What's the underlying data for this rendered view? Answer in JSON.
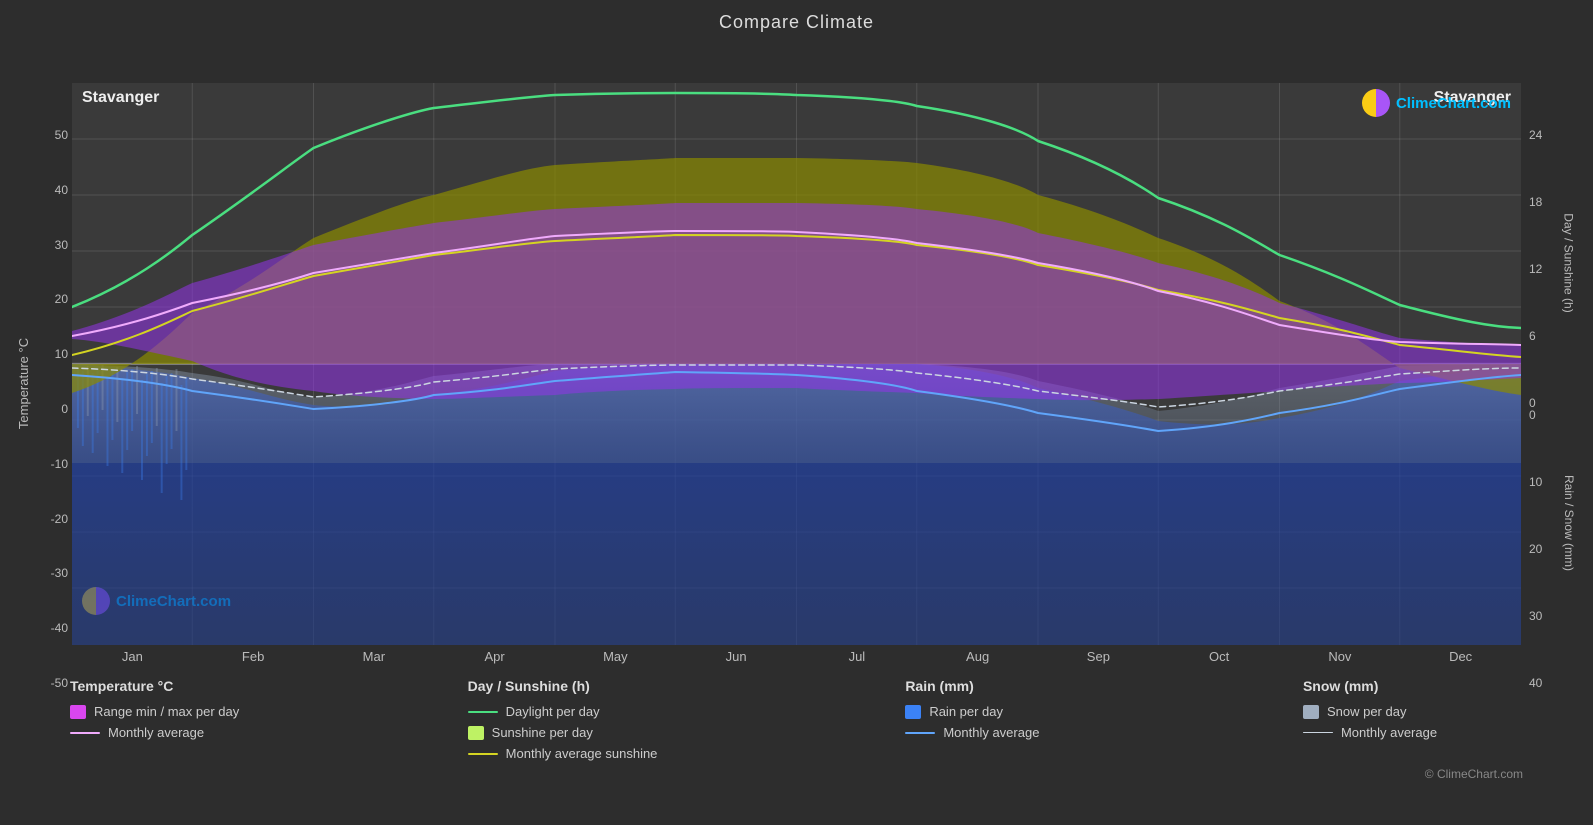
{
  "page": {
    "title": "Compare Climate",
    "bg_color": "#2d2d2d"
  },
  "header": {
    "city_left": "Stavanger",
    "city_right": "Stavanger",
    "logo_text": "ClimeChart.com"
  },
  "chart": {
    "y_axis_left_title": "Temperature °C",
    "y_axis_right_top_title": "Day / Sunshine (h)",
    "y_axis_right_bottom_title": "Rain / Snow (mm)",
    "y_left_labels": [
      "50",
      "40",
      "30",
      "20",
      "10",
      "0",
      "-10",
      "-20",
      "-30",
      "-40",
      "-50"
    ],
    "y_right_top_labels": [
      "24",
      "18",
      "12",
      "6",
      "0"
    ],
    "y_right_bottom_labels": [
      "0",
      "10",
      "20",
      "30",
      "40"
    ],
    "x_labels": [
      "Jan",
      "Feb",
      "Mar",
      "Apr",
      "May",
      "Jun",
      "Jul",
      "Aug",
      "Sep",
      "Oct",
      "Nov",
      "Dec"
    ]
  },
  "legend": {
    "groups": [
      {
        "title": "Temperature °C",
        "items": [
          {
            "type": "swatch",
            "color": "#d946ef",
            "label": "Range min / max per day"
          },
          {
            "type": "line",
            "color": "#f0abfc",
            "label": "Monthly average"
          }
        ]
      },
      {
        "title": "Day / Sunshine (h)",
        "items": [
          {
            "type": "line",
            "color": "#4ade80",
            "label": "Daylight per day"
          },
          {
            "type": "swatch",
            "color": "#bef264",
            "label": "Sunshine per day"
          },
          {
            "type": "line",
            "color": "#d4d422",
            "label": "Monthly average sunshine"
          }
        ]
      },
      {
        "title": "Rain (mm)",
        "items": [
          {
            "type": "swatch",
            "color": "#3b82f6",
            "label": "Rain per day"
          },
          {
            "type": "line",
            "color": "#60a5fa",
            "label": "Monthly average"
          }
        ]
      },
      {
        "title": "Snow (mm)",
        "items": [
          {
            "type": "swatch",
            "color": "#a0aec0",
            "label": "Snow per day"
          },
          {
            "type": "line",
            "color": "#cbd5e0",
            "label": "Monthly average"
          }
        ]
      }
    ]
  },
  "copyright": "© ClimeChart.com"
}
